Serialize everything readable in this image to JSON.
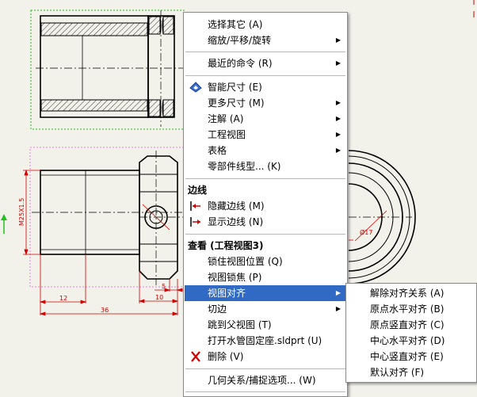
{
  "drawing": {
    "dimensions": {
      "thread": "M25X1.5",
      "d12": "12",
      "d36": "36",
      "d10": "10",
      "d5": "5",
      "phi17": "Ø17"
    }
  },
  "context_menu": {
    "items": [
      {
        "label": "选择其它 (A)"
      },
      {
        "label": "缩放/平移/旋转"
      },
      {
        "label": "最近的命令 (R)"
      },
      {
        "label": "智能尺寸 (E)"
      },
      {
        "label": "更多尺寸 (M)"
      },
      {
        "label": "注解 (A)"
      },
      {
        "label": "工程视图"
      },
      {
        "label": "表格"
      },
      {
        "label": "零部件线型... (K)"
      }
    ],
    "section_edge": "边线",
    "edge_items": [
      {
        "label": "隐藏边线 (M)"
      },
      {
        "label": "显示边线 (N)"
      }
    ],
    "section_view": "查看 (工程视图3)",
    "view_items": [
      {
        "label": "锁住视图位置 (Q)"
      },
      {
        "label": "视图锁焦 (P)"
      },
      {
        "label": "视图对齐"
      },
      {
        "label": "切边"
      },
      {
        "label": "跳到父视图 (T)"
      },
      {
        "label": "打开水管固定座.sldprt (U)"
      },
      {
        "label": "删除 (V)"
      }
    ],
    "bottom_item": "几何关系/捕捉选项... (W)"
  },
  "submenu": {
    "items": [
      {
        "label": "解除对齐关系 (A)"
      },
      {
        "label": "原点水平对齐 (B)"
      },
      {
        "label": "原点竖直对齐 (C)"
      },
      {
        "label": "中心水平对齐 (D)"
      },
      {
        "label": "中心竖直对齐 (E)"
      },
      {
        "label": "默认对齐 (F)"
      }
    ]
  },
  "colors": {
    "highlight": "#316ac5",
    "dimension": "#d40000",
    "selection_green": "#22c022",
    "selection_pink": "#e080e0",
    "delete_icon": "#d00000"
  },
  "icons": {
    "smart_dimension": "smart-dimension-icon",
    "hide_edge": "hide-edge-icon",
    "show_edge": "show-edge-icon",
    "delete": "red-x-icon",
    "submenu_arrow": "triangle-right-icon"
  }
}
